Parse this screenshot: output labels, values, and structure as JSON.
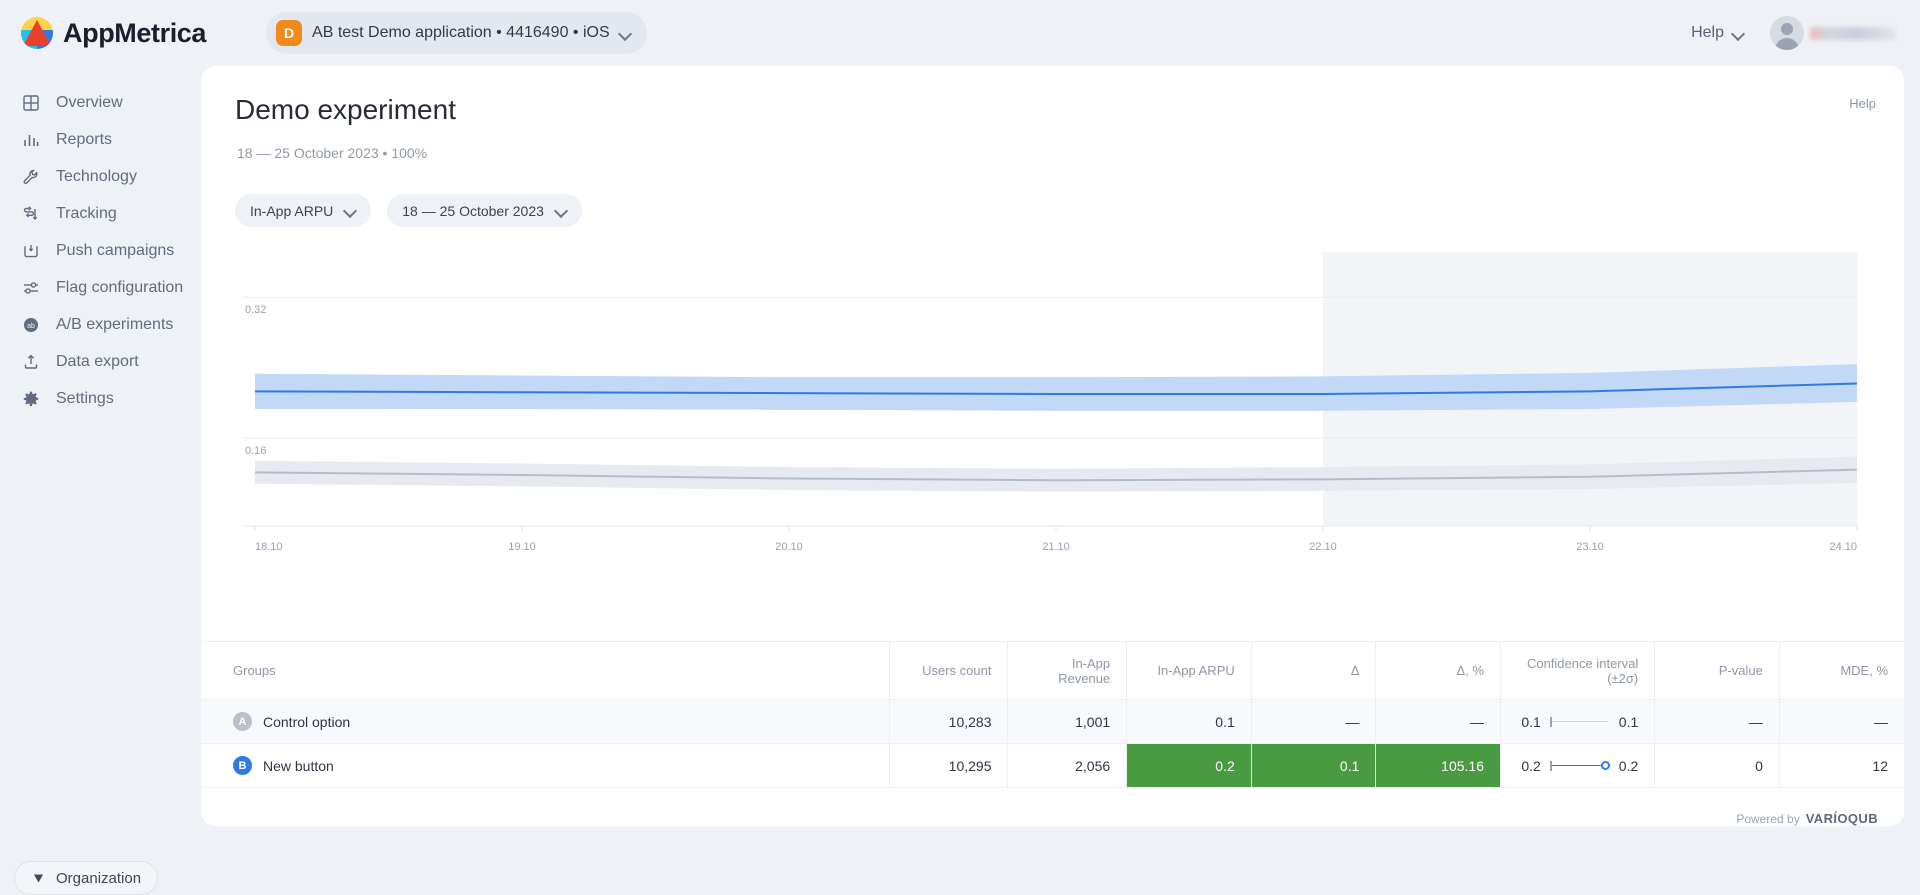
{
  "brand": {
    "name": "AppMetrica",
    "logo_icon": "appmetrica-logo-icon"
  },
  "topbar": {
    "app_switcher": {
      "badge": "D",
      "label": "AB test Demo application  •  4416490  •  iOS",
      "chevron_icon": "chevron-down-icon"
    },
    "help_label": "Help",
    "avatar_icon": "user-avatar-icon"
  },
  "sidebar": {
    "items": [
      {
        "label": "Overview",
        "icon": "grid-icon"
      },
      {
        "label": "Reports",
        "icon": "bar-chart-icon"
      },
      {
        "label": "Technology",
        "icon": "wrench-icon"
      },
      {
        "label": "Tracking",
        "icon": "tracking-arrows-icon"
      },
      {
        "label": "Push campaigns",
        "icon": "push-bell-icon"
      },
      {
        "label": "Flag configuration",
        "icon": "sliders-icon"
      },
      {
        "label": "A/B experiments",
        "icon": "ab-circle-icon"
      },
      {
        "label": "Data export",
        "icon": "upload-icon"
      },
      {
        "label": "Settings",
        "icon": "gear-icon"
      }
    ],
    "organization_button": {
      "label": "Organization",
      "icon": "diamond-icon"
    }
  },
  "main": {
    "title": "Demo experiment",
    "subtitle": "18 — 25 October 2023  •  100%",
    "help_label": "Help",
    "filters": [
      {
        "label": "In-App ARPU",
        "chevron_icon": "chevron-down-icon"
      },
      {
        "label": "18 — 25 October 2023",
        "chevron_icon": "chevron-down-icon"
      }
    ]
  },
  "chart_data": {
    "type": "line",
    "title": "",
    "xlabel": "",
    "ylabel": "",
    "x": [
      "18.10",
      "19.10",
      "20.10",
      "21.10",
      "22.10",
      "23.10",
      "24.10"
    ],
    "ytick_labels": [
      "0.32",
      "0.16"
    ],
    "ytick_values": [
      0.32,
      0.16
    ],
    "ylim": [
      0.06,
      0.36
    ],
    "grid": true,
    "legend_position": "none",
    "shaded_region": {
      "from": "22.10",
      "to": "24.10",
      "color": "#f2f4f8"
    },
    "series": [
      {
        "name": "New button",
        "color": "#2f7ae5",
        "band_color": "#bed6f7",
        "values": [
          0.213,
          0.212,
          0.211,
          0.21,
          0.21,
          0.213,
          0.222
        ],
        "band_upper": [
          0.233,
          0.231,
          0.229,
          0.229,
          0.23,
          0.234,
          0.244
        ],
        "band_lower": [
          0.193,
          0.193,
          0.192,
          0.191,
          0.191,
          0.193,
          0.201
        ]
      },
      {
        "name": "Control option",
        "color": "#b6bcc7",
        "band_color": "#e5e8ee",
        "values": [
          0.121,
          0.118,
          0.114,
          0.112,
          0.113,
          0.116,
          0.124
        ],
        "band_upper": [
          0.134,
          0.131,
          0.127,
          0.125,
          0.127,
          0.13,
          0.139
        ],
        "band_lower": [
          0.108,
          0.105,
          0.101,
          0.099,
          0.1,
          0.102,
          0.109
        ]
      }
    ]
  },
  "table": {
    "columns": [
      "Groups",
      "Users count",
      "In-App Revenue",
      "In-App ARPU",
      "Δ",
      "Δ, %",
      "Confidence interval (±2σ)",
      "P-value",
      "MDE, %"
    ],
    "rows": [
      {
        "badge": "A",
        "name": "Control option",
        "users_count": "10,283",
        "revenue": "1,001",
        "arpu": "0.1",
        "delta": "—",
        "delta_pct": "—",
        "ci_low": "0.1",
        "ci_high": "0.1",
        "p_value": "—",
        "mde": "—"
      },
      {
        "badge": "B",
        "name": "New button",
        "users_count": "10,295",
        "revenue": "2,056",
        "arpu": "0.2",
        "delta": "0.1",
        "delta_pct": "105.16",
        "ci_low": "0.2",
        "ci_high": "0.2",
        "p_value": "0",
        "mde": "12"
      }
    ]
  },
  "footer": {
    "powered_prefix": "Powered by",
    "powered_brand": "VARÍOQUB"
  },
  "colors": {
    "accent_blue": "#2f7ae5",
    "highlight_green": "#4a9a42",
    "app_badge_orange": "#f08a1d",
    "page_bg": "#eef1f6"
  }
}
